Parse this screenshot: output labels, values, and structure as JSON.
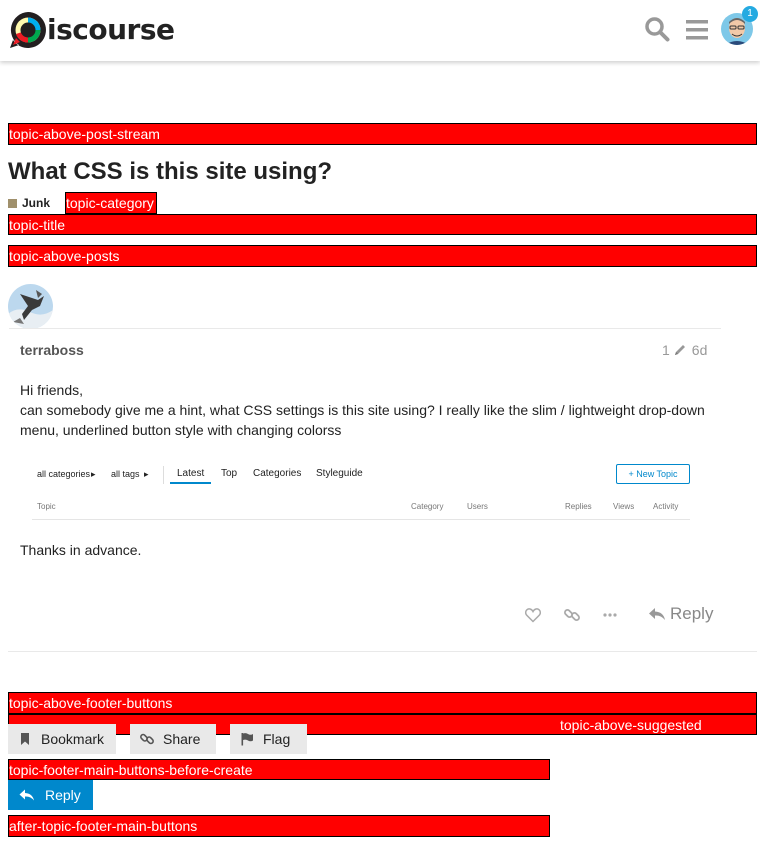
{
  "header": {
    "logo_text": "iscourse",
    "notification_count": "1",
    "icons": {
      "search": "search-icon",
      "menu": "hamburger-menu-icon",
      "user": "user-avatar"
    }
  },
  "outlets": {
    "above_post_stream": "topic-above-post-stream",
    "category": "topic-category",
    "title": "topic-title",
    "above_posts": "topic-above-posts",
    "above_footer_buttons": "topic-above-footer-buttons",
    "above_suggested": "topic-above-suggested",
    "footer_before_create": "topic-footer-main-buttons-before-create",
    "after_footer": "after-topic-footer-main-buttons"
  },
  "topic": {
    "title": "What CSS is this site using?",
    "category": {
      "name": "Junk",
      "color": "#a0906c"
    }
  },
  "post": {
    "username": "terraboss",
    "edit_count": "1",
    "age": "6d",
    "body_lines": [
      "Hi friends,",
      "can somebody give me a hint, what CSS settings is this site using? I really like the slim / lightweight drop-down menu, underlined button style with changing colorss"
    ],
    "closing": "Thanks in advance.",
    "reply_label": "Reply"
  },
  "embedded_screenshot": {
    "all_categories": "all categories",
    "all_tags": "all tags",
    "nav": [
      "Latest",
      "Top",
      "Categories",
      "Styleguide"
    ],
    "new_topic": "+ New Topic",
    "columns": [
      "Topic",
      "Category",
      "Users",
      "Replies",
      "Views",
      "Activity"
    ]
  },
  "footer": {
    "bookmark": "Bookmark",
    "share": "Share",
    "flag": "Flag",
    "reply": "Reply"
  },
  "colors": {
    "accent": "#0088cc",
    "outlet": "#ff0000",
    "badge": "#25aae1"
  }
}
